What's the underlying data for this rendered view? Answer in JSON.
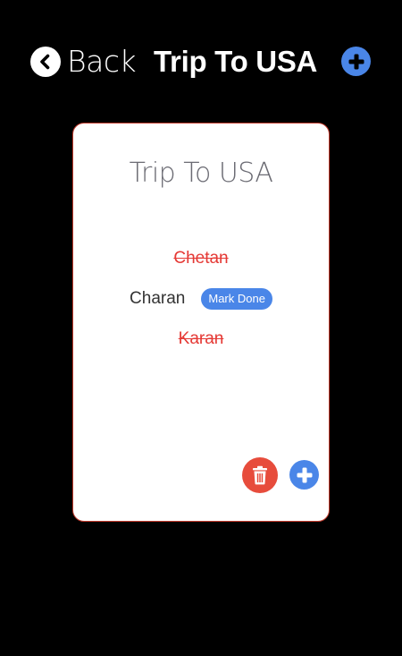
{
  "header": {
    "back_label": "Back",
    "title": "Trip To USA",
    "add_icon": "plus-circle-icon",
    "back_icon": "chevron-left-circle-icon"
  },
  "card": {
    "title": "Trip To USA",
    "members": [
      {
        "name": "Chetan",
        "done": true
      },
      {
        "name": "Charan",
        "done": false,
        "action_label": "Mark Done"
      },
      {
        "name": "Karan",
        "done": true
      }
    ],
    "delete_icon": "trash-icon",
    "add_icon": "plus-circle-icon"
  },
  "colors": {
    "background": "#000000",
    "card": "#ffffff",
    "card_border": "#c0392b",
    "accent_blue": "#4a86e8",
    "danger_red": "#e74c3c",
    "done_text": "#e53935"
  }
}
